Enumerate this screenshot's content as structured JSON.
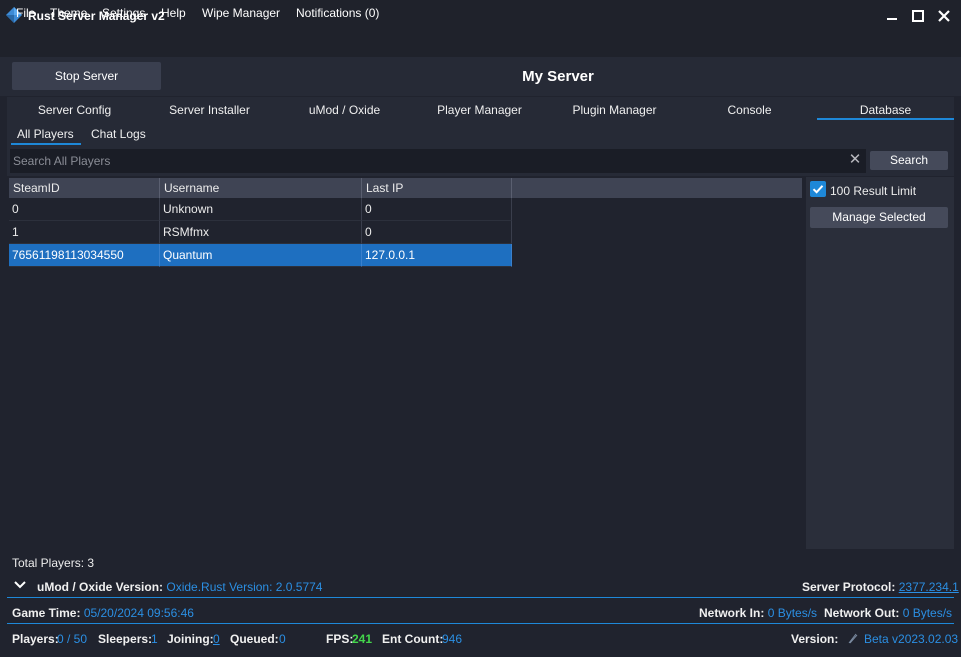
{
  "app": {
    "title": "Rust Server Manager v2"
  },
  "menu": [
    "File",
    "Theme",
    "Settings",
    "Help",
    "Wipe Manager",
    "Notifications (0)"
  ],
  "header": {
    "stop_button": "Stop Server",
    "server_name": "My Server"
  },
  "tabs": [
    "Server Config",
    "Server Installer",
    "uMod / Oxide",
    "Player Manager",
    "Plugin Manager",
    "Console",
    "Database"
  ],
  "active_tab": "Database",
  "subtabs": [
    "All Players",
    "Chat Logs"
  ],
  "active_subtab": "All Players",
  "search": {
    "placeholder": "Search All Players",
    "value": "",
    "button": "Search"
  },
  "grid": {
    "columns": [
      "SteamID",
      "Username",
      "Last IP"
    ],
    "rows": [
      {
        "steamid": "0",
        "username": "Unknown",
        "last_ip": "0",
        "selected": false
      },
      {
        "steamid": "1",
        "username": "RSMfmx",
        "last_ip": "0",
        "selected": false
      },
      {
        "steamid": "76561198113034550",
        "username": "Quantum",
        "last_ip": "127.0.0.1",
        "selected": true
      }
    ]
  },
  "side": {
    "limit_label": "100 Result Limit",
    "limit_checked": true,
    "manage_button": "Manage Selected"
  },
  "footer": {
    "total_players": "Total Players: 3",
    "umod_label": "uMod / Oxide Version:",
    "umod_value": "Oxide.Rust Version: 2.0.5774",
    "protocol_label": "Server Protocol:",
    "protocol_value": "2377.234.1",
    "game_time_label": "Game Time:",
    "game_time_value": "05/20/2024 09:56:46",
    "net_in_label": "Network In:",
    "net_in_value": "0 Bytes/s",
    "net_out_label": "Network Out:",
    "net_out_value": "0 Bytes/s",
    "players_label": "Players:",
    "players_value": "0 / 50",
    "sleepers_label": "Sleepers:",
    "sleepers_value": "1",
    "joining_label": "Joining:",
    "joining_value": "0",
    "queued_label": "Queued:",
    "queued_value": "0",
    "fps_label": "FPS:",
    "fps_value": "241",
    "ent_label": "Ent Count:",
    "ent_value": "946",
    "version_label": "Version:",
    "version_value": "Beta v2023.02.03"
  },
  "colors": {
    "accent": "#1e88d8",
    "link": "#2b8fe3",
    "fps": "#43d64b",
    "background": "#20232e"
  },
  "icons": {
    "app": "rust-diamond-icon",
    "minimize": "minimize-icon",
    "maximize": "maximize-icon",
    "close": "close-icon",
    "clear": "clear-search-icon",
    "collapse": "chevron-down-icon",
    "version": "pencil-icon",
    "check": "checkmark-icon"
  }
}
